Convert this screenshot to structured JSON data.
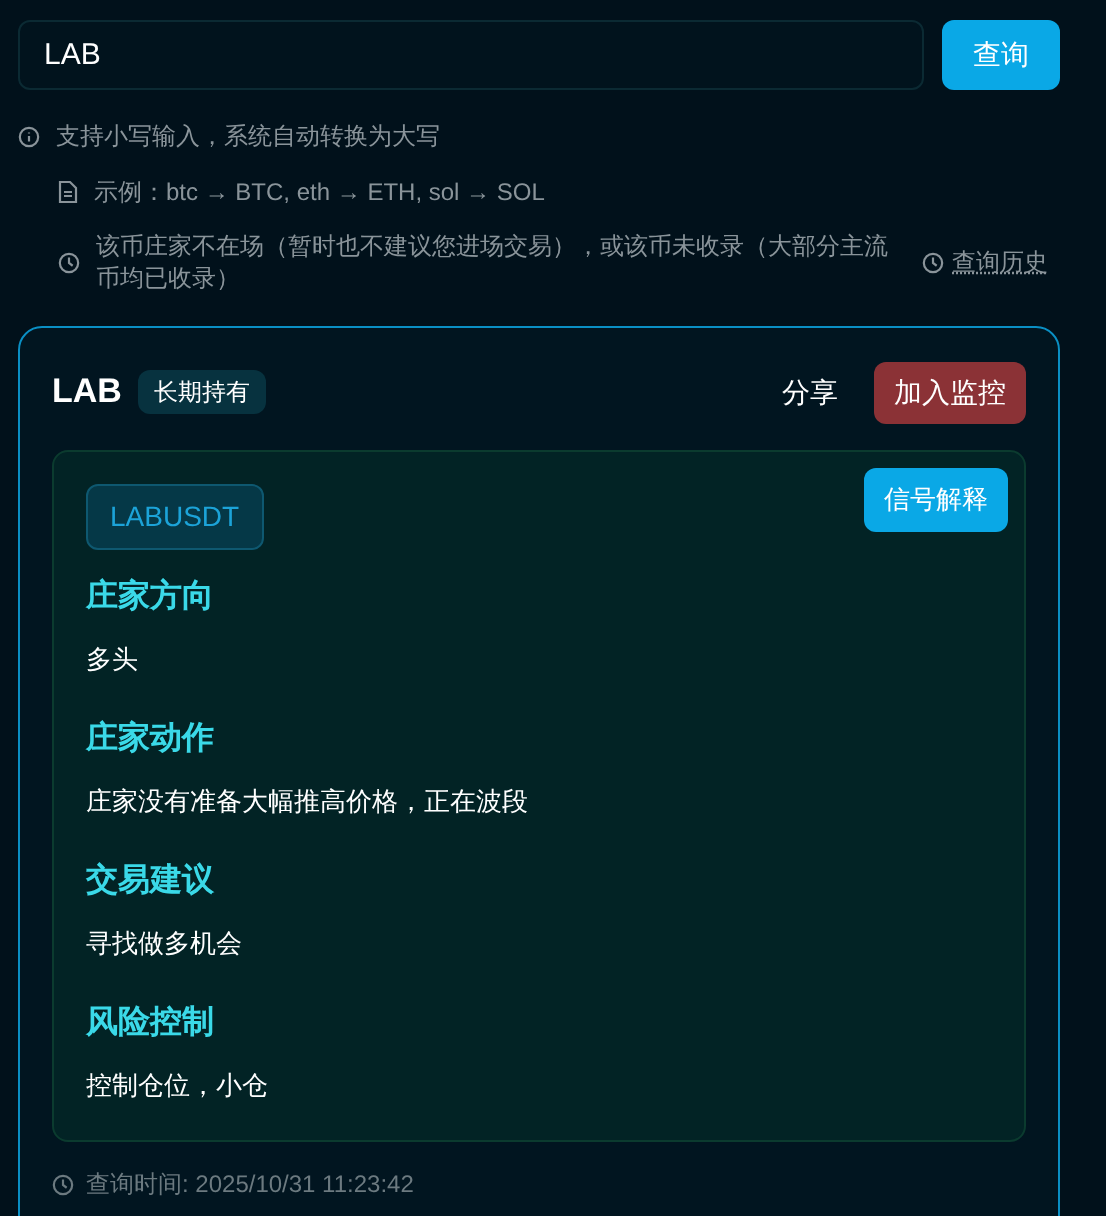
{
  "search": {
    "value": "LAB",
    "button": "查询"
  },
  "hints": [
    {
      "kind": "info",
      "text": "支持小写输入，系统自动转换为大写"
    },
    {
      "kind": "doc",
      "text": "示例：btc → BTC, eth → ETH, sol → SOL"
    },
    {
      "kind": "clock",
      "text": "该币庄家不在场（暂时也不建议您进场交易），或该币未收录（大部分主流币均已收录）"
    }
  ],
  "history_link": "查询历史",
  "result": {
    "symbol": "LAB",
    "tag": "长期持有",
    "actions": [
      {
        "label": "分享",
        "kind": "ghost"
      },
      {
        "label": "加入监控",
        "kind": "danger"
      }
    ],
    "pair": "LABUSDT",
    "explain_button": "信号解释",
    "sections": [
      {
        "title": "庄家方向",
        "body": "多头"
      },
      {
        "title": "庄家动作",
        "body": "庄家没有准备大幅推高价格，正在波段"
      },
      {
        "title": "交易建议",
        "body": "寻找做多机会"
      },
      {
        "title": "风险控制",
        "body": "控制仓位，小仓"
      }
    ],
    "footer": "查询时间: 2025/10/31 11:23:42"
  }
}
